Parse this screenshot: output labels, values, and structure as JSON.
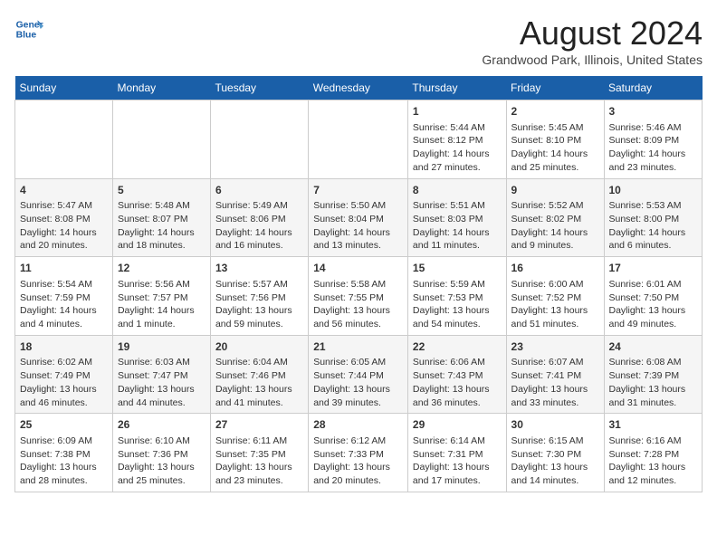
{
  "header": {
    "logo_line1": "General",
    "logo_line2": "Blue",
    "title": "August 2024",
    "subtitle": "Grandwood Park, Illinois, United States"
  },
  "weekdays": [
    "Sunday",
    "Monday",
    "Tuesday",
    "Wednesday",
    "Thursday",
    "Friday",
    "Saturday"
  ],
  "weeks": [
    [
      {
        "day": "",
        "info": ""
      },
      {
        "day": "",
        "info": ""
      },
      {
        "day": "",
        "info": ""
      },
      {
        "day": "",
        "info": ""
      },
      {
        "day": "1",
        "info": "Sunrise: 5:44 AM\nSunset: 8:12 PM\nDaylight: 14 hours\nand 27 minutes."
      },
      {
        "day": "2",
        "info": "Sunrise: 5:45 AM\nSunset: 8:10 PM\nDaylight: 14 hours\nand 25 minutes."
      },
      {
        "day": "3",
        "info": "Sunrise: 5:46 AM\nSunset: 8:09 PM\nDaylight: 14 hours\nand 23 minutes."
      }
    ],
    [
      {
        "day": "4",
        "info": "Sunrise: 5:47 AM\nSunset: 8:08 PM\nDaylight: 14 hours\nand 20 minutes."
      },
      {
        "day": "5",
        "info": "Sunrise: 5:48 AM\nSunset: 8:07 PM\nDaylight: 14 hours\nand 18 minutes."
      },
      {
        "day": "6",
        "info": "Sunrise: 5:49 AM\nSunset: 8:06 PM\nDaylight: 14 hours\nand 16 minutes."
      },
      {
        "day": "7",
        "info": "Sunrise: 5:50 AM\nSunset: 8:04 PM\nDaylight: 14 hours\nand 13 minutes."
      },
      {
        "day": "8",
        "info": "Sunrise: 5:51 AM\nSunset: 8:03 PM\nDaylight: 14 hours\nand 11 minutes."
      },
      {
        "day": "9",
        "info": "Sunrise: 5:52 AM\nSunset: 8:02 PM\nDaylight: 14 hours\nand 9 minutes."
      },
      {
        "day": "10",
        "info": "Sunrise: 5:53 AM\nSunset: 8:00 PM\nDaylight: 14 hours\nand 6 minutes."
      }
    ],
    [
      {
        "day": "11",
        "info": "Sunrise: 5:54 AM\nSunset: 7:59 PM\nDaylight: 14 hours\nand 4 minutes."
      },
      {
        "day": "12",
        "info": "Sunrise: 5:56 AM\nSunset: 7:57 PM\nDaylight: 14 hours\nand 1 minute."
      },
      {
        "day": "13",
        "info": "Sunrise: 5:57 AM\nSunset: 7:56 PM\nDaylight: 13 hours\nand 59 minutes."
      },
      {
        "day": "14",
        "info": "Sunrise: 5:58 AM\nSunset: 7:55 PM\nDaylight: 13 hours\nand 56 minutes."
      },
      {
        "day": "15",
        "info": "Sunrise: 5:59 AM\nSunset: 7:53 PM\nDaylight: 13 hours\nand 54 minutes."
      },
      {
        "day": "16",
        "info": "Sunrise: 6:00 AM\nSunset: 7:52 PM\nDaylight: 13 hours\nand 51 minutes."
      },
      {
        "day": "17",
        "info": "Sunrise: 6:01 AM\nSunset: 7:50 PM\nDaylight: 13 hours\nand 49 minutes."
      }
    ],
    [
      {
        "day": "18",
        "info": "Sunrise: 6:02 AM\nSunset: 7:49 PM\nDaylight: 13 hours\nand 46 minutes."
      },
      {
        "day": "19",
        "info": "Sunrise: 6:03 AM\nSunset: 7:47 PM\nDaylight: 13 hours\nand 44 minutes."
      },
      {
        "day": "20",
        "info": "Sunrise: 6:04 AM\nSunset: 7:46 PM\nDaylight: 13 hours\nand 41 minutes."
      },
      {
        "day": "21",
        "info": "Sunrise: 6:05 AM\nSunset: 7:44 PM\nDaylight: 13 hours\nand 39 minutes."
      },
      {
        "day": "22",
        "info": "Sunrise: 6:06 AM\nSunset: 7:43 PM\nDaylight: 13 hours\nand 36 minutes."
      },
      {
        "day": "23",
        "info": "Sunrise: 6:07 AM\nSunset: 7:41 PM\nDaylight: 13 hours\nand 33 minutes."
      },
      {
        "day": "24",
        "info": "Sunrise: 6:08 AM\nSunset: 7:39 PM\nDaylight: 13 hours\nand 31 minutes."
      }
    ],
    [
      {
        "day": "25",
        "info": "Sunrise: 6:09 AM\nSunset: 7:38 PM\nDaylight: 13 hours\nand 28 minutes."
      },
      {
        "day": "26",
        "info": "Sunrise: 6:10 AM\nSunset: 7:36 PM\nDaylight: 13 hours\nand 25 minutes."
      },
      {
        "day": "27",
        "info": "Sunrise: 6:11 AM\nSunset: 7:35 PM\nDaylight: 13 hours\nand 23 minutes."
      },
      {
        "day": "28",
        "info": "Sunrise: 6:12 AM\nSunset: 7:33 PM\nDaylight: 13 hours\nand 20 minutes."
      },
      {
        "day": "29",
        "info": "Sunrise: 6:14 AM\nSunset: 7:31 PM\nDaylight: 13 hours\nand 17 minutes."
      },
      {
        "day": "30",
        "info": "Sunrise: 6:15 AM\nSunset: 7:30 PM\nDaylight: 13 hours\nand 14 minutes."
      },
      {
        "day": "31",
        "info": "Sunrise: 6:16 AM\nSunset: 7:28 PM\nDaylight: 13 hours\nand 12 minutes."
      }
    ]
  ]
}
